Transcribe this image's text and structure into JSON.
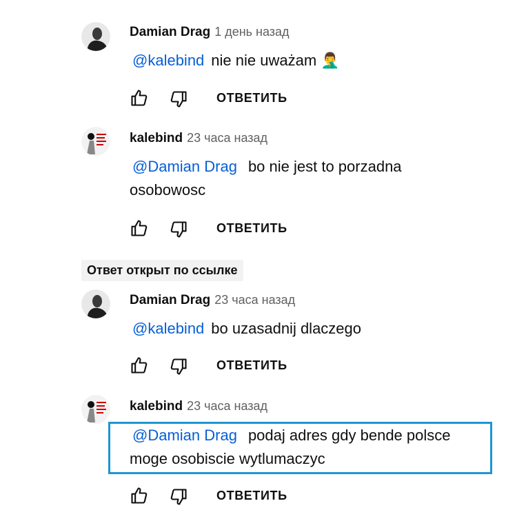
{
  "colors": {
    "mention": "#065fd4",
    "highlight_border": "#1b96d3",
    "chip_bg": "#f2f2f2",
    "time": "#606060"
  },
  "pinned_chip": "Ответ открыт по ссылке",
  "comments": [
    {
      "author": "Damian Drag",
      "time": "1 день назад",
      "mention": "@kalebind",
      "line1": "nie nie uważam 🤦‍♂️",
      "line2": "",
      "reply_label": "ОТВЕТИТЬ",
      "avatar": "avatar-damian"
    },
    {
      "author": "kalebind",
      "time": "23 часа назад",
      "mention": "@Damian Drag",
      "line1": "bo nie jest to porzadna",
      "line2": "osobowosc",
      "reply_label": "ОТВЕТИТЬ",
      "avatar": "avatar-kalebind"
    },
    {
      "author": "Damian Drag",
      "time": "23 часа назад",
      "mention": "@kalebind",
      "line1": "bo uzasadnij dlaczego",
      "line2": "",
      "reply_label": "ОТВЕТИТЬ",
      "avatar": "avatar-damian"
    },
    {
      "author": "kalebind",
      "time": "23 часа назад",
      "mention": "@Damian Drag",
      "line1": "podaj adres gdy bende polsce",
      "line2": "moge osobiscie wytlumaczyc",
      "reply_label": "ОТВЕТИТЬ",
      "avatar": "avatar-kalebind"
    }
  ]
}
